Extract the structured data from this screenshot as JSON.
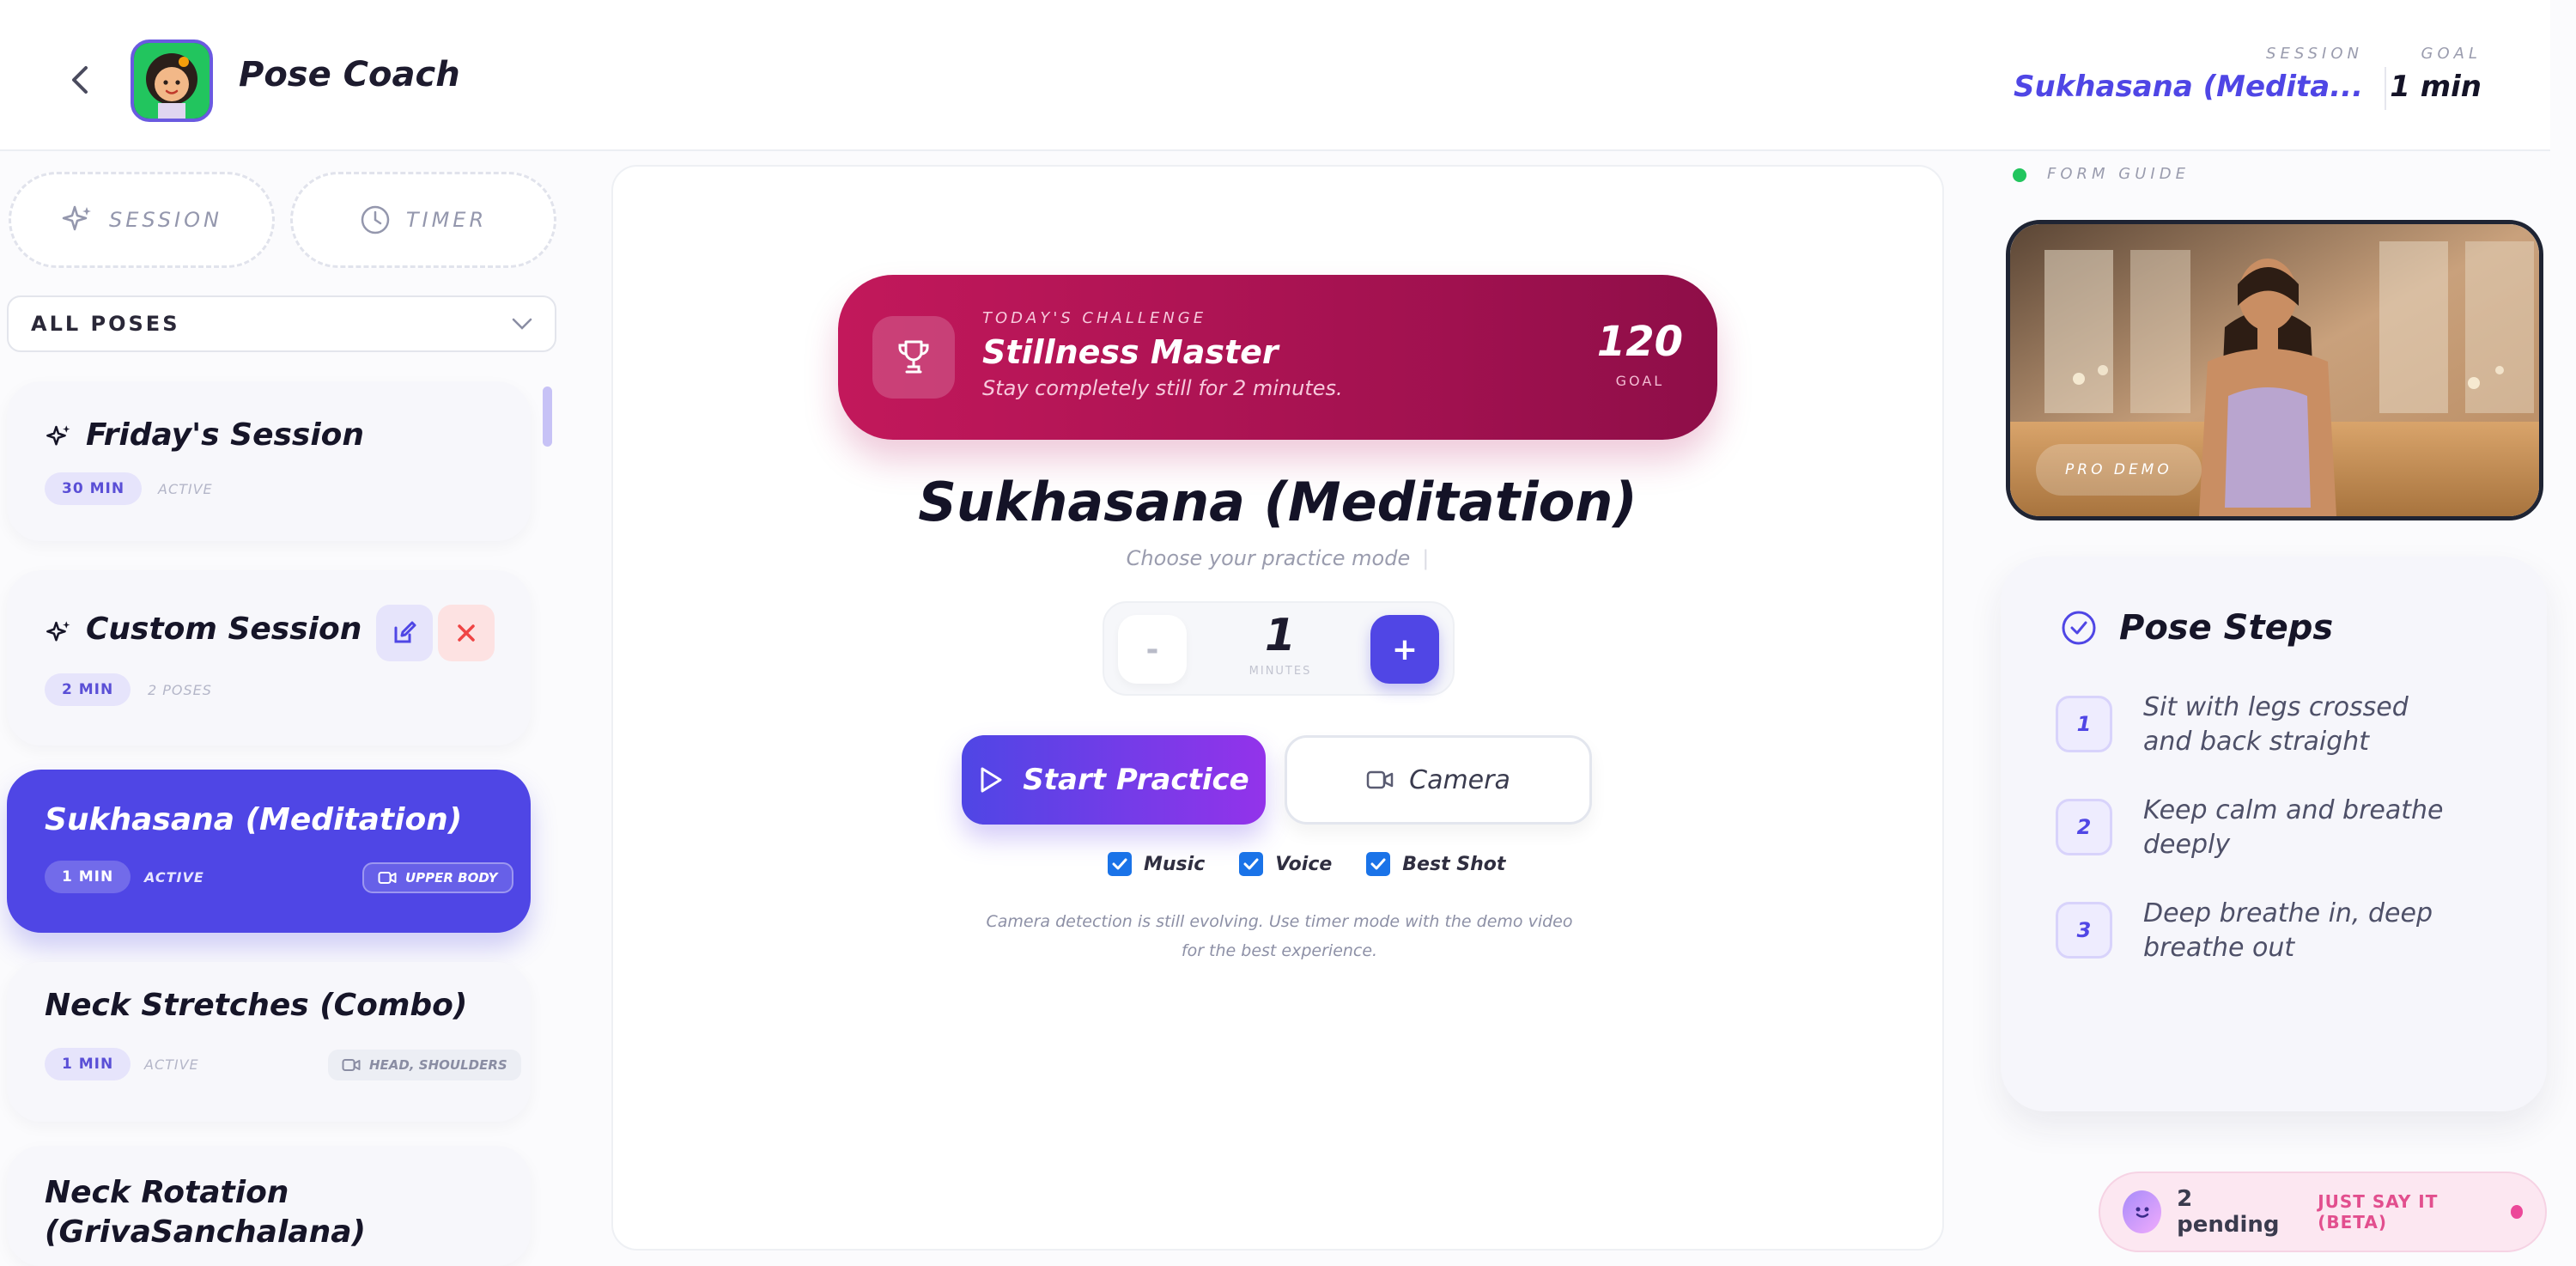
{
  "header": {
    "app_title": "Pose Coach",
    "session_label": "SESSION",
    "session_value": "Sukhasana (Medita...",
    "goal_label": "GOAL",
    "goal_value": "1 min"
  },
  "sidebar": {
    "mode_buttons": [
      {
        "label": "SESSION",
        "icon": "sparkles-icon"
      },
      {
        "label": "TIMER",
        "icon": "clock-icon"
      }
    ],
    "filter": {
      "value": "ALL POSES"
    },
    "cards": [
      {
        "title": "Friday's Session",
        "duration": "30 MIN",
        "status": "ACTIVE"
      },
      {
        "title": "Custom Session",
        "duration": "2 MIN",
        "status": "2 POSES"
      },
      {
        "title": "Sukhasana (Meditation)",
        "duration": "1 MIN",
        "status": "ACTIVE",
        "area": "UPPER BODY"
      },
      {
        "title": "Neck Stretches (Combo)",
        "duration": "1 MIN",
        "status": "ACTIVE",
        "area": "HEAD, SHOULDERS"
      },
      {
        "title": "Neck Rotation (GrivaSanchalana)"
      }
    ]
  },
  "challenge": {
    "kicker": "TODAY'S CHALLENGE",
    "title": "Stillness Master",
    "subtitle": "Stay completely still for 2 minutes.",
    "goal_value": "120",
    "goal_label": "GOAL"
  },
  "main": {
    "pose_title": "Sukhasana (Meditation)",
    "mode_hint": "Choose your practice mode",
    "stepper": {
      "minus": "-",
      "value": "1",
      "unit": "MINUTES",
      "plus": "+"
    },
    "start_label": "Start Practice",
    "camera_label": "Camera",
    "options": [
      {
        "label": "Music",
        "checked": true
      },
      {
        "label": "Voice",
        "checked": true
      },
      {
        "label": "Best Shot",
        "checked": true
      }
    ],
    "note": "Camera detection is still evolving. Use timer mode with the demo video for the best experience."
  },
  "form_guide": {
    "label": "FORM GUIDE",
    "video_badge": "PRO DEMO"
  },
  "pose_steps": {
    "title": "Pose Steps",
    "steps": [
      {
        "num": "1",
        "text": "Sit with legs crossed and back straight"
      },
      {
        "num": "2",
        "text": "Keep calm and breathe deeply"
      },
      {
        "num": "3",
        "text": "Deep breathe in, deep breathe out"
      }
    ]
  },
  "pending": {
    "count": "2 pending",
    "cta": "JUST SAY IT (BETA)"
  },
  "colors": {
    "accent": "#4f46e5",
    "challenge": "#c2185b",
    "checkbox": "#1a73e8",
    "status_dot": "#22c55e"
  }
}
